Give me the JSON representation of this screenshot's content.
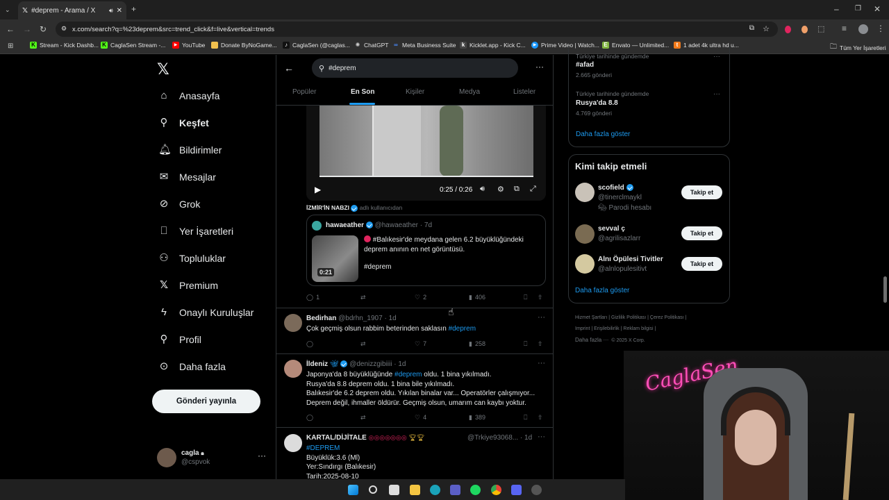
{
  "browser": {
    "tab_title": "#deprem - Arama / X",
    "url": "x.com/search?q=%23deprem&src=trend_click&f=live&vertical=trends",
    "bookmarks": [
      "Stream - Kick Dashb...",
      "CaglaSen Stream -...",
      "YouTube",
      "Donate ByNoGame...",
      "CaglaSen (@caglas...",
      "ChatGPT",
      "Meta Business Suite",
      "Kicklet.app - Kick C...",
      "Prime Video | Watch...",
      "Envato — Unlimited...",
      "1 adet 4k ultra hd u..."
    ],
    "all_bookmarks": "Tüm Yer İşaretleri"
  },
  "nav": {
    "items": [
      "Anasayfa",
      "Keşfet",
      "Bildirimler",
      "Mesajlar",
      "Grok",
      "Yer İşaretleri",
      "Topluluklar",
      "Premium",
      "Onaylı Kuruluşlar",
      "Profil",
      "Daha fazla"
    ],
    "post_button": "Gönderi yayınla",
    "account_name": "cagla",
    "account_handle": "@cspvok"
  },
  "search": {
    "query": "#deprem",
    "tabs": [
      "Popüler",
      "En Son",
      "Kişiler",
      "Medya",
      "Listeler"
    ],
    "active_tab": "En Son"
  },
  "post1": {
    "video_time": "0:25 / 0:26",
    "reposter_name": "İZMİR'İN NABZI",
    "reposter_suffix": "adlı kullanıcıdan",
    "quote_name": "hawaeather",
    "quote_handle": "@hawaeather",
    "quote_time": "7d",
    "quote_text": "#Balıkesir'de meydana gelen 6.2 büyüklüğündeki deprem anının en net görüntüsü.",
    "quote_tag": "#deprem",
    "quote_duration": "0:21",
    "replies": "1",
    "likes": "2",
    "views": "406"
  },
  "post2": {
    "name": "Bedirhan",
    "handle": "@bdrhn_1907",
    "time": "1d",
    "text": "Çok geçmiş olsun rabbim beterinden saklasın",
    "tag": "#deprem",
    "likes": "7",
    "views": "258"
  },
  "post3": {
    "name": "İldeniz",
    "handle": "@denizzgibiiii",
    "time": "1d",
    "line1_pre": "Japonya'da 8 büyüklüğünde",
    "line1_tag": "#deprem",
    "line1_post": "oldu. 1 bina yıkılmadı.",
    "line2": "Rusya'da 8.8 deprem oldu. 1 bina bile yıkılmadı.",
    "line3": "Balıkesir'de 6.2 deprem oldu. Yıkılan binalar var... Operatörler çalışmıyor...",
    "line4": "Deprem değil, ihmaller öldürür. Geçmiş olsun, umarım can kaybı yoktur.",
    "likes": "4",
    "views": "389"
  },
  "post4": {
    "name": "KARTAL/DİJİTALE",
    "handle": "@Trkiye93068...",
    "time": "1d",
    "tag": "#DEPREM",
    "line1": "Büyüklük:3.6 (Ml)",
    "line2": "Yer:Sındırgı (Balıkesir)",
    "line3": "Tarih:2025-08-10"
  },
  "trends": {
    "t1_context": "Türkiye tarihinde gündemde",
    "t1_name": "#afad",
    "t1_count": "2.665 gönderi",
    "t2_context": "Türkiye tarihinde gündemde",
    "t2_name": "Rusya'da 8.8",
    "t2_count": "4.769 gönderi",
    "show_more": "Daha fazla göster"
  },
  "who_to_follow": {
    "title": "Kimi takip etmeli",
    "follow_label": "Takip et",
    "users": [
      {
        "name": "scofield",
        "handle": "@tinerclmaykl",
        "note": "Parodi hesabı"
      },
      {
        "name": "sevval ç",
        "handle": "@agrilisazlarr"
      },
      {
        "name": "Alnı Öpülesi Tivitler",
        "handle": "@alnlopulesitivt"
      }
    ],
    "show_more": "Daha fazla göster"
  },
  "footer": {
    "links": [
      "Hizmet Şartları",
      "Gizlilik Politikası",
      "Çerez Politikası",
      "Imprint",
      "Erişilebilirlik",
      "Reklam bilgisi",
      "Daha fazla ···",
      "© 2025 X Corp."
    ]
  },
  "overlay": {
    "signature": "CaglaSen"
  },
  "colors": {
    "accent": "#1d9bf0",
    "bg": "#000000",
    "border": "#2f3336"
  }
}
